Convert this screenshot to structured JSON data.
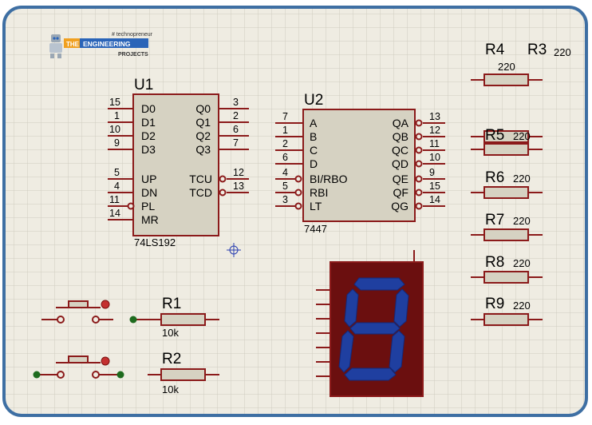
{
  "logo": {
    "tagline": "# technopreneur",
    "badge": "THE",
    "name": "ENGINEERING",
    "sub": "PROJECTS"
  },
  "colors": {
    "frame": "#3e6fa3",
    "grid_bg": "#efece2",
    "grid_line": "#cfccc0",
    "wire": "#8b1a1a",
    "chip_fill": "#d6d2c2",
    "display_fill": "#6b0f0f",
    "segment": "#1f3fa0",
    "junction": "#1e6b1e",
    "marker": "#c43030"
  },
  "u1": {
    "ref": "U1",
    "part": "74LS192",
    "left_pins": [
      {
        "num": "15",
        "name": "D0"
      },
      {
        "num": "1",
        "name": "D1"
      },
      {
        "num": "10",
        "name": "D2"
      },
      {
        "num": "9",
        "name": "D3"
      },
      {
        "num": "5",
        "name": "UP"
      },
      {
        "num": "4",
        "name": "DN"
      },
      {
        "num": "11",
        "name": "PL"
      },
      {
        "num": "14",
        "name": "MR"
      }
    ],
    "right_pins": [
      {
        "num": "3",
        "name": "Q0"
      },
      {
        "num": "2",
        "name": "Q1"
      },
      {
        "num": "6",
        "name": "Q2"
      },
      {
        "num": "7",
        "name": "Q3"
      },
      {
        "num": "12",
        "name": "TCU"
      },
      {
        "num": "13",
        "name": "TCD"
      }
    ]
  },
  "u2": {
    "ref": "U2",
    "part": "7447",
    "left_pins": [
      {
        "num": "7",
        "name": "A"
      },
      {
        "num": "1",
        "name": "B"
      },
      {
        "num": "2",
        "name": "C"
      },
      {
        "num": "6",
        "name": "D"
      },
      {
        "num": "4",
        "name": "BI/RBO"
      },
      {
        "num": "5",
        "name": "RBI"
      },
      {
        "num": "3",
        "name": "LT"
      }
    ],
    "right_pins": [
      {
        "num": "13",
        "name": "QA"
      },
      {
        "num": "12",
        "name": "QB"
      },
      {
        "num": "11",
        "name": "QC"
      },
      {
        "num": "10",
        "name": "QD"
      },
      {
        "num": "9",
        "name": "QE"
      },
      {
        "num": "15",
        "name": "QF"
      },
      {
        "num": "14",
        "name": "QG"
      }
    ]
  },
  "resistors": [
    {
      "ref": "R1",
      "value": "10k"
    },
    {
      "ref": "R2",
      "value": "10k"
    },
    {
      "ref": "R3",
      "value": "220"
    },
    {
      "ref": "R4",
      "value": "220"
    },
    {
      "ref": "R5",
      "value": "220"
    },
    {
      "ref": "R6",
      "value": "220"
    },
    {
      "ref": "R7",
      "value": "220"
    },
    {
      "ref": "R8",
      "value": "220"
    },
    {
      "ref": "R9",
      "value": "220"
    }
  ]
}
